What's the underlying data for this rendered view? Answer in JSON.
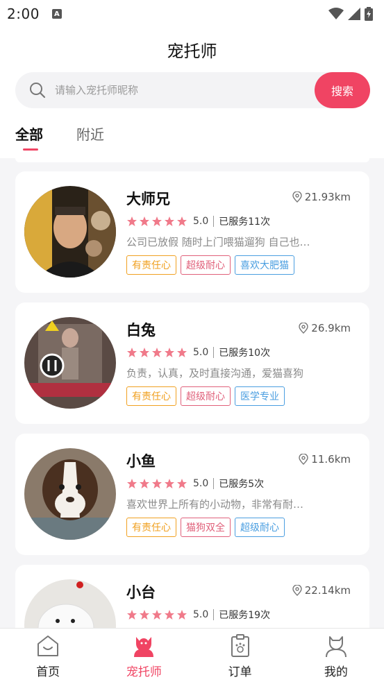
{
  "status_bar": {
    "time": "2:00",
    "notif_glyph": "A"
  },
  "header": {
    "title": "宠托师"
  },
  "search": {
    "placeholder": "请输入宠托师昵称",
    "button_label": "搜索"
  },
  "tabs": [
    {
      "label": "全部",
      "active": true
    },
    {
      "label": "附近",
      "active": false
    }
  ],
  "sitters": [
    {
      "name": "大师兄",
      "distance": "21.93km",
      "score": "5.0",
      "served": "已服务11次",
      "desc": "公司已放假 随时上门喂猫遛狗 自己也…",
      "tags": [
        "有责任心",
        "超级耐心",
        "喜欢大肥猫"
      ]
    },
    {
      "name": "白兔",
      "distance": "26.9km",
      "score": "5.0",
      "served": "已服务10次",
      "desc": "负责，认真，及时直接沟通，爱猫喜狗",
      "tags": [
        "有责任心",
        "超级耐心",
        "医学专业"
      ]
    },
    {
      "name": "小鱼",
      "distance": "11.6km",
      "score": "5.0",
      "served": "已服务5次",
      "desc": "喜欢世界上所有的小动物，非常有耐…",
      "tags": [
        "有责任心",
        "猫狗双全",
        "超级耐心"
      ]
    },
    {
      "name": "小台",
      "distance": "22.14km",
      "score": "5.0",
      "served": "已服务19次",
      "desc": "",
      "tags": []
    }
  ],
  "tag_colors": {
    "orange": "#f0a020",
    "pink": "#e0607a",
    "blue": "#4a9ee0"
  },
  "star_color": "#f07a8a",
  "accent": "#f04463",
  "nav": [
    {
      "label": "首页",
      "icon": "home-icon",
      "active": false
    },
    {
      "label": "宠托师",
      "icon": "sitter-icon",
      "active": true
    },
    {
      "label": "订单",
      "icon": "order-icon",
      "active": false
    },
    {
      "label": "我的",
      "icon": "profile-icon",
      "active": false
    }
  ]
}
